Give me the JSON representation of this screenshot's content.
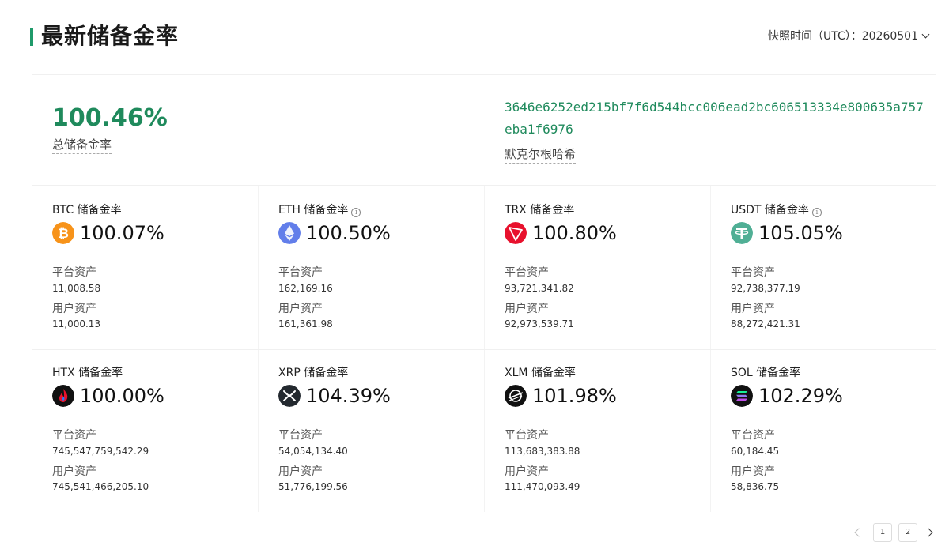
{
  "header": {
    "title": "最新储备金率",
    "snapshot_label": "快照时间（UTC）：",
    "snapshot_value": "20260501"
  },
  "summary": {
    "total_rate": "100.46%",
    "total_label": "总储备金率",
    "merkle_hash": "3646e6252ed215bf7f6d544bcc006ead2bc606513334e800635a757eba1f6976",
    "merkle_label": "默克尔根哈希"
  },
  "assets": [
    {
      "symbol": "BTC",
      "title_suffix": "储备金率",
      "rate": "100.07%",
      "icon": "btc-icon",
      "color": "#f7931a",
      "has_info": false,
      "platform_label": "平台资产",
      "platform_value": "11,008.58",
      "user_label": "用户资产",
      "user_value": "11,000.13"
    },
    {
      "symbol": "ETH",
      "title_suffix": "储备金率",
      "rate": "100.50%",
      "icon": "eth-icon",
      "color": "#627eea",
      "has_info": true,
      "platform_label": "平台资产",
      "platform_value": "162,169.16",
      "user_label": "用户资产",
      "user_value": "161,361.98"
    },
    {
      "symbol": "TRX",
      "title_suffix": "储备金率",
      "rate": "100.80%",
      "icon": "trx-icon",
      "color": "#e8112d",
      "has_info": false,
      "platform_label": "平台资产",
      "platform_value": "93,721,341.82",
      "user_label": "用户资产",
      "user_value": "92,973,539.71"
    },
    {
      "symbol": "USDT",
      "title_suffix": "储备金率",
      "rate": "105.05%",
      "icon": "usdt-icon",
      "color": "#50af95",
      "has_info": true,
      "platform_label": "平台资产",
      "platform_value": "92,738,377.19",
      "user_label": "用户资产",
      "user_value": "88,272,421.31"
    },
    {
      "symbol": "HTX",
      "title_suffix": "储备金率",
      "rate": "100.00%",
      "icon": "htx-icon",
      "color": "#111111",
      "has_info": false,
      "platform_label": "平台资产",
      "platform_value": "745,547,759,542.29",
      "user_label": "用户资产",
      "user_value": "745,541,466,205.10"
    },
    {
      "symbol": "XRP",
      "title_suffix": "储备金率",
      "rate": "104.39%",
      "icon": "xrp-icon",
      "color": "#23292f",
      "has_info": false,
      "platform_label": "平台资产",
      "platform_value": "54,054,134.40",
      "user_label": "用户资产",
      "user_value": "51,776,199.56"
    },
    {
      "symbol": "XLM",
      "title_suffix": "储备金率",
      "rate": "101.98%",
      "icon": "xlm-icon",
      "color": "#111111",
      "has_info": false,
      "platform_label": "平台资产",
      "platform_value": "113,683,383.88",
      "user_label": "用户资产",
      "user_value": "111,470,093.49"
    },
    {
      "symbol": "SOL",
      "title_suffix": "储备金率",
      "rate": "102.29%",
      "icon": "sol-icon",
      "color": "#111111",
      "has_info": false,
      "platform_label": "平台资产",
      "platform_value": "60,184.45",
      "user_label": "用户资产",
      "user_value": "58,836.75"
    }
  ],
  "pagination": {
    "pages": [
      "1",
      "2"
    ]
  },
  "colors": {
    "accent": "#1f8a5c",
    "title_bar": "#1f9a6a"
  }
}
